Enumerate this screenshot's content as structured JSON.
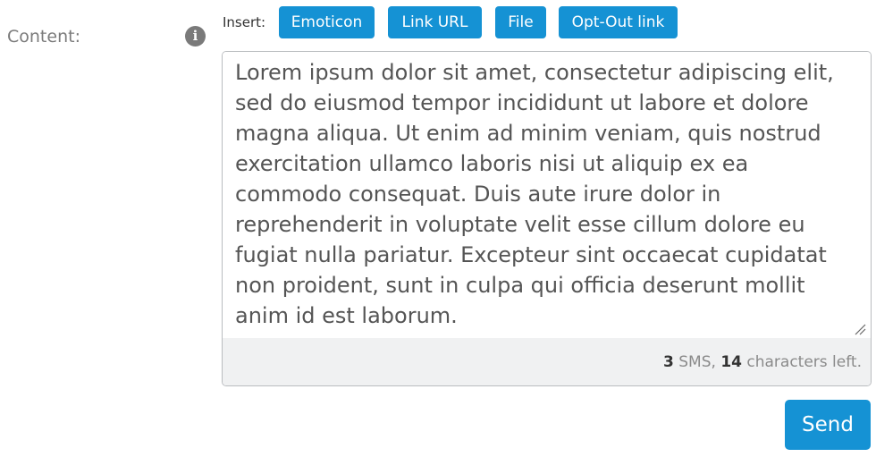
{
  "form": {
    "content_label": "Content:",
    "info_icon": "info-icon",
    "insert_label": "Insert:"
  },
  "insert_buttons": [
    {
      "label": "Emoticon"
    },
    {
      "label": "Link URL"
    },
    {
      "label": "File"
    },
    {
      "label": "Opt-Out link"
    }
  ],
  "message": {
    "value": "Lorem ipsum dolor sit amet, consectetur adipiscing elit, sed do eiusmod tempor incididunt ut labore et dolore magna aliqua. Ut enim ad minim veniam, quis nostrud exercitation ullamco laboris nisi ut aliquip ex ea commodo consequat. Duis aute irure dolor in reprehenderit in voluptate velit esse cillum dolore eu fugiat nulla pariatur. Excepteur sint occaecat cupidatat non proident, sunt in culpa qui officia deserunt mollit anim id est laborum."
  },
  "counter": {
    "sms_count": "3",
    "sms_label": " SMS, ",
    "chars_left": "14",
    "chars_label": " characters left."
  },
  "actions": {
    "send_label": "Send"
  },
  "colors": {
    "accent": "#1592d4",
    "counter_bg": "#f0f1f2"
  }
}
